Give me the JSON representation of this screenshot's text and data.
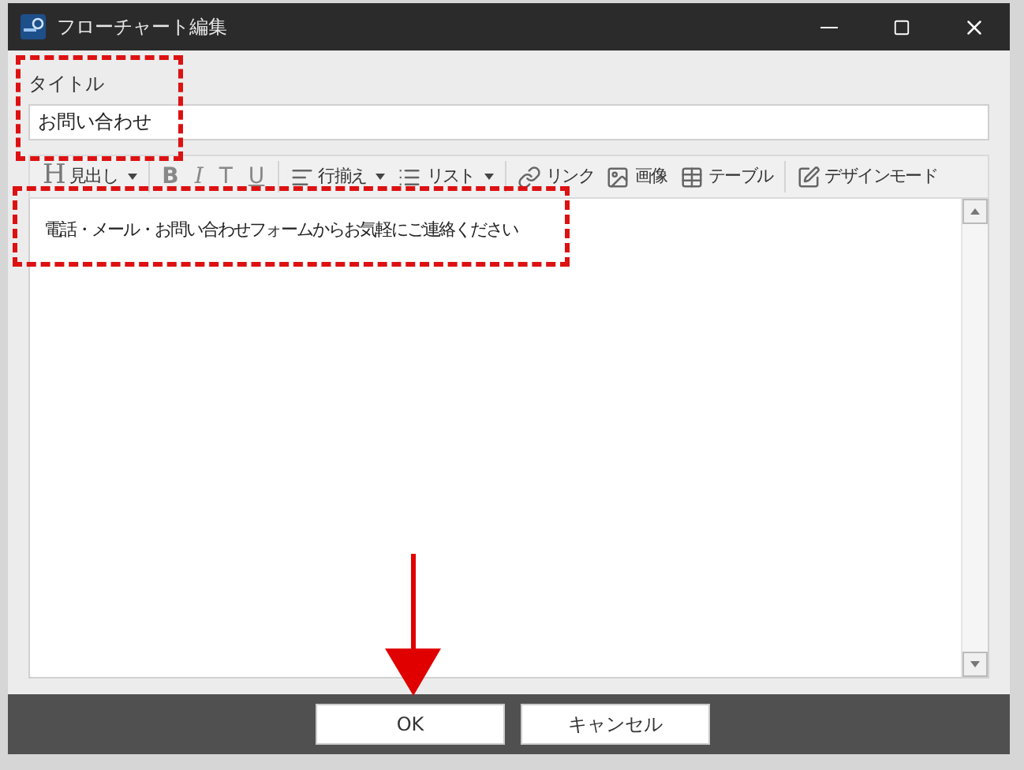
{
  "window": {
    "title": "フローチャート編集"
  },
  "title_field": {
    "label": "タイトル",
    "value": "お問い合わせ"
  },
  "toolbar": [
    {
      "kind": "menu",
      "glyph": "H",
      "label": "見出し"
    },
    {
      "kind": "format",
      "label": "B"
    },
    {
      "kind": "format",
      "label": "I"
    },
    {
      "kind": "format",
      "label": "T"
    },
    {
      "kind": "format",
      "label": "U"
    },
    {
      "kind": "menu",
      "label": "行揃え"
    },
    {
      "kind": "menu",
      "label": "リスト"
    },
    {
      "kind": "tool",
      "label": "リンク"
    },
    {
      "kind": "tool",
      "label": "画像"
    },
    {
      "kind": "tool",
      "label": "テーブル"
    },
    {
      "kind": "tool",
      "label": "デザインモード"
    }
  ],
  "editor": {
    "text": "電話・メール・お問い合わせフォームからお気軽にご連絡ください"
  },
  "buttons": [
    {
      "label": "OK"
    },
    {
      "label": "キャンセル"
    }
  ]
}
